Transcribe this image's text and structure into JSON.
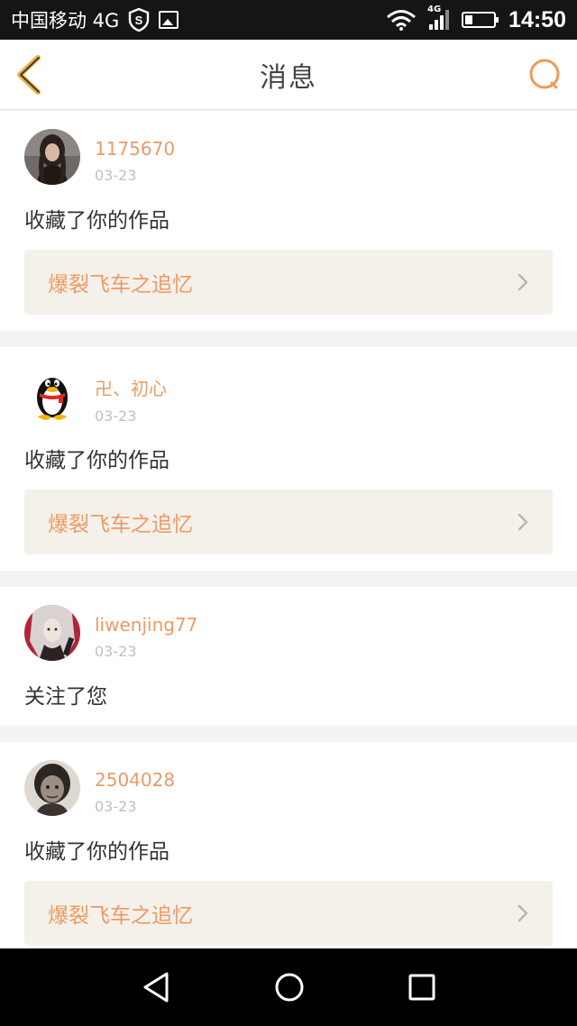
{
  "status_bar": {
    "carrier": "中国移动 4G",
    "network_tag": "4G",
    "time": "14:50",
    "battery_level": 0.25
  },
  "header": {
    "title": "消息"
  },
  "messages": [
    {
      "username": "1175670",
      "date": "03-23",
      "action": "收藏了你的作品",
      "work_title": "爆裂飞车之追忆",
      "avatar": "photo-woman-avatar"
    },
    {
      "username": "卍、初心",
      "date": "03-23",
      "action": "收藏了你的作品",
      "work_title": "爆裂飞车之追忆",
      "avatar": "qq-penguin-avatar"
    },
    {
      "username": "liwenjing77",
      "date": "03-23",
      "action": "关注了您",
      "avatar": "anime-girl-avatar"
    },
    {
      "username": "2504028",
      "date": "03-23",
      "action": "收藏了你的作品",
      "work_title": "爆裂飞车之追忆",
      "avatar": "elderly-photo-avatar"
    }
  ],
  "colors": {
    "accent": "#e99b68",
    "work_bg": "#f3f1ea"
  },
  "icons": [
    "back-chevron-icon",
    "search-icon",
    "chevron-right-icon",
    "nav-back-icon",
    "nav-home-icon",
    "nav-recents-icon"
  ]
}
